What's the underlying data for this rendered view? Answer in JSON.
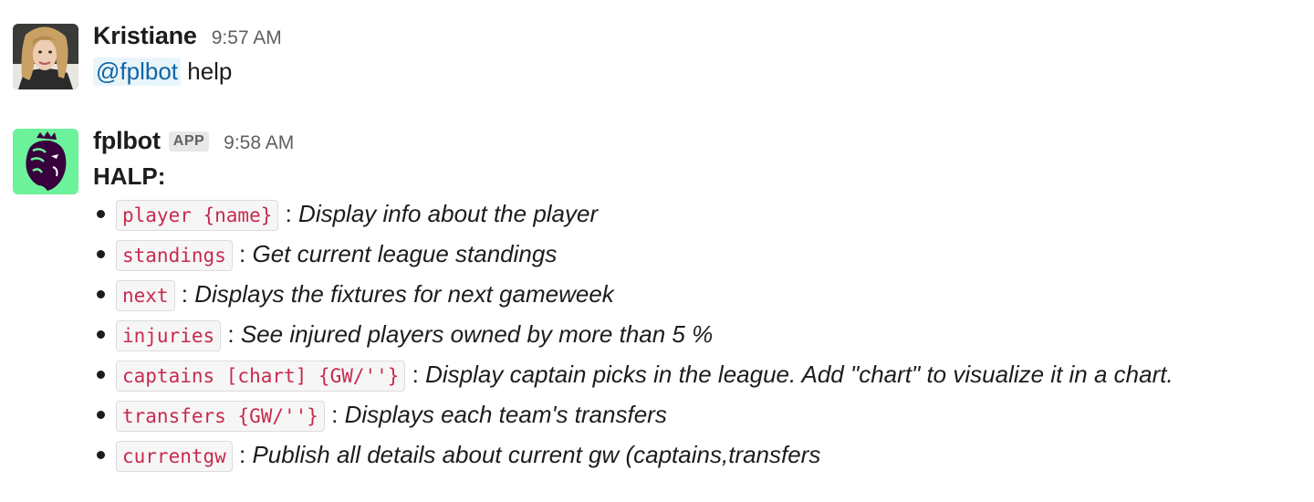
{
  "messages": [
    {
      "author": "Kristiane",
      "time": "9:57 AM",
      "avatar": "user-photo",
      "mention": "@fplbot",
      "text": "help"
    },
    {
      "author": "fplbot",
      "badge": "APP",
      "time": "9:58 AM",
      "avatar": "premier-league-lion-logo",
      "heading": "HALP:",
      "commands": [
        {
          "code": "player {name}",
          "sep": " : ",
          "desc": "Display info about the player"
        },
        {
          "code": "standings",
          "sep": " : ",
          "desc": "Get current league standings"
        },
        {
          "code": "next",
          "sep": " : ",
          "desc": "Displays the fixtures for next gameweek"
        },
        {
          "code": "injuries",
          "sep": " : ",
          "desc": "See injured players owned by more than 5 %"
        },
        {
          "code": "captains [chart] {GW/''}",
          "sep": " : ",
          "desc": "Display captain picks in the league. Add \"chart\" to visualize it in a chart."
        },
        {
          "code": "transfers {GW/''}",
          "sep": " : ",
          "desc": "Displays each team's transfers"
        },
        {
          "code": "currentgw",
          "sep": " : ",
          "desc": "Publish all details about current gw (captains,transfers"
        }
      ]
    }
  ],
  "colors": {
    "mention_bg": "#e8f5fa",
    "mention_fg": "#1264a3",
    "code_fg": "#c82a4e",
    "bot_avatar_bg": "#6cf29b"
  }
}
